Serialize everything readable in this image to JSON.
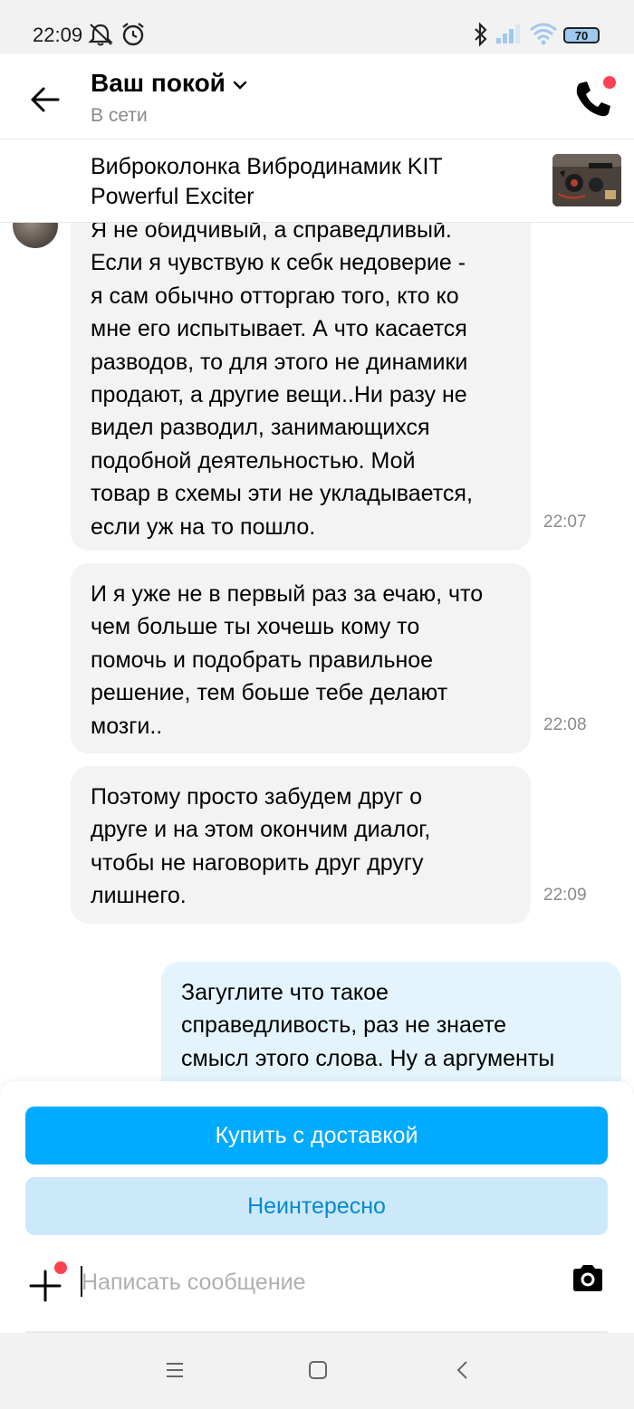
{
  "status_bar": {
    "time": "22:09",
    "battery": "70",
    "icons": [
      "muted-bell-icon",
      "alarm-icon",
      "bluetooth-icon",
      "signal-icon",
      "wifi-icon",
      "battery-icon"
    ]
  },
  "header": {
    "title": "Ваш покой",
    "status": "В сети",
    "icons": [
      "back-arrow-icon",
      "chevron-down-icon",
      "phone-icon"
    ],
    "accent_dot_color": "#ff4053"
  },
  "product": {
    "title": "Виброколонка Вибродинамик KIT Powerful Exciter"
  },
  "messages": [
    {
      "direction": "incoming",
      "text": "Я не обидчивый, а справедливый.\nЕсли я чувствую к себк недоверие -\nя сам обычно отторгаю того, кто ко\nмне его испытывает. А что касается\nразводов, то для этого не динамики\nпродают, а другие вещи..Ни разу не\nвидел разводил, занимающихся\nподобной деятельностью. Мой\nтовар в схемы эти не укладывается,\nесли уж на то пошло.",
      "time": "22:07"
    },
    {
      "direction": "incoming",
      "text": "И я уже не в первый раз за ечаю, что\nчем больше ты хочешь кому то\nпомочь и подобрать правильное\nрешение, тем боьше тебе делают\nмозги..",
      "time": "22:08"
    },
    {
      "direction": "incoming",
      "text": "Поэтому просто забудем друг о\nдруге и на этом окончим диалог,\nчтобы не наговорить друг другу\nлишнего.",
      "time": "22:09"
    },
    {
      "direction": "outgoing",
      "text": "Загуглите что такое\nсправедливость, раз не знаете\nсмысл этого слова. Ну а аргументы",
      "time": ""
    }
  ],
  "actions": {
    "buy_label": "Купить с доставкой",
    "not_interested_label": "Неинтересно"
  },
  "composer": {
    "placeholder": "Написать сообщение",
    "value": "",
    "icons": [
      "plus-icon",
      "camera-icon"
    ]
  },
  "nav_bar": {
    "icons": [
      "menu-icon",
      "home-square-icon",
      "back-chevron-icon"
    ]
  },
  "colors": {
    "accent": "#00aaff",
    "accent_light": "#cbe9fb",
    "accent_text": "#0788d0",
    "incoming_bubble": "#f3f3f3",
    "outgoing_bubble": "#e3f4fd",
    "notification_dot": "#ff4053"
  }
}
